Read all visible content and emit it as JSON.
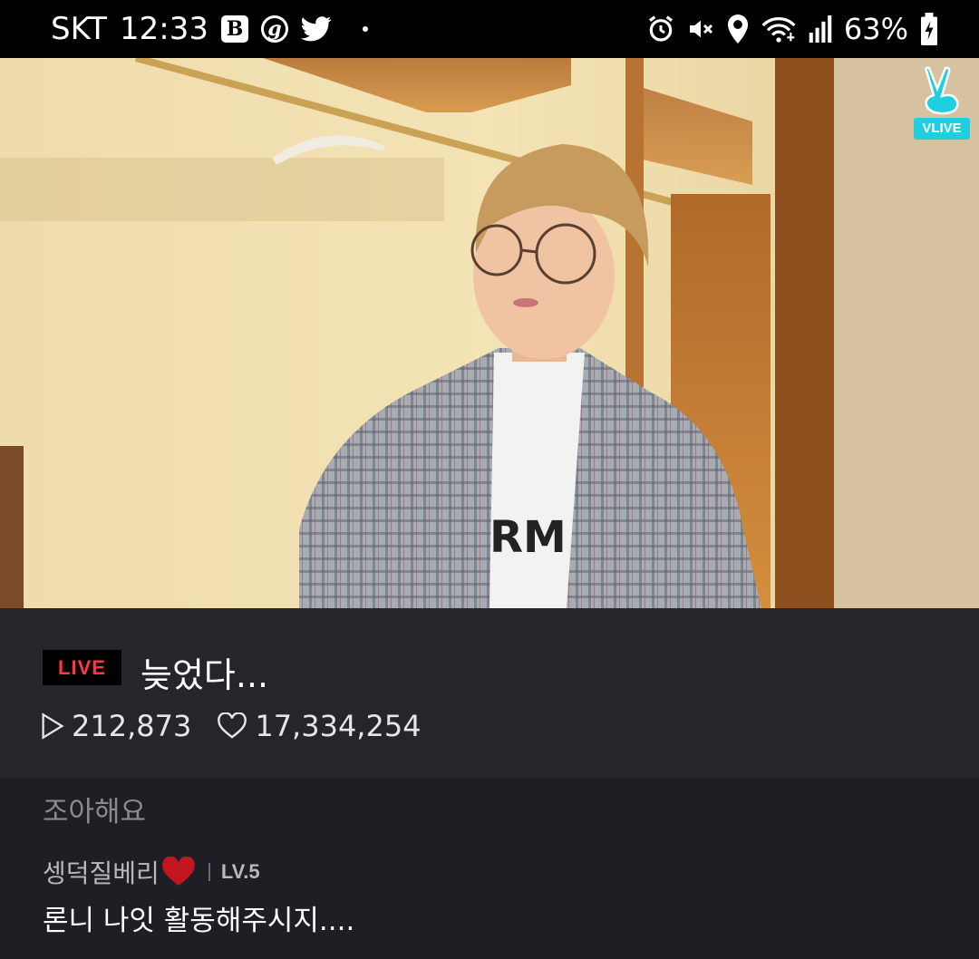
{
  "status_bar": {
    "carrier": "SKT",
    "time": "12:33",
    "app_icons": [
      "band-icon",
      "g-icon",
      "twitter-icon"
    ],
    "right_icons": [
      "alarm-icon",
      "mute-icon",
      "location-icon",
      "wifi-icon",
      "signal-icon"
    ],
    "battery": "63%"
  },
  "video": {
    "watermark": "VLIVE"
  },
  "live_info": {
    "badge": "LIVE",
    "title": "늦었다...",
    "plays": "212,873",
    "likes": "17,334,254"
  },
  "comments": [
    {
      "text": "조아해요"
    },
    {
      "user": "셍덕질베리",
      "level": "LV.5",
      "text": "론니 나잇 활동해주시지...."
    }
  ],
  "colors": {
    "live_red": "#ff3646",
    "vlive_cyan": "#1ecfe0",
    "panel_bg": "#25262c",
    "comments_bg": "#1e1f24"
  }
}
